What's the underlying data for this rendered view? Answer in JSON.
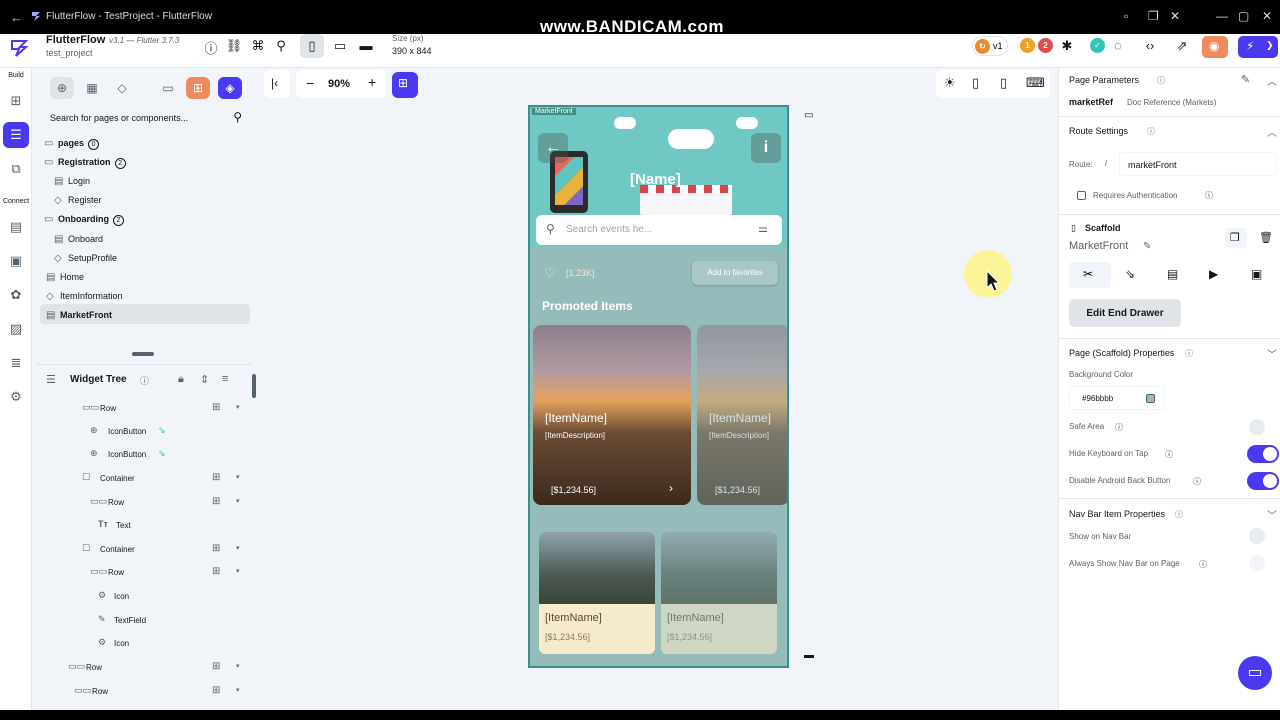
{
  "window": {
    "title": "FlutterFlow - TestProject - FlutterFlow",
    "watermark": "www.BANDICAM.com"
  },
  "header": {
    "brand": "FlutterFlow",
    "version": "v3.1 — Flutter 3.7.3",
    "project": "test_project",
    "size_label": "Size (px)",
    "size_value": "390 x 844",
    "version_pill": "v1",
    "warn_count": "1",
    "error_count": "2"
  },
  "rail": {
    "build_label": "Build",
    "connect_label": "Connect"
  },
  "left_panel": {
    "search_placeholder": "Search for pages or components...",
    "tree": [
      {
        "label": "pages",
        "badge": "0"
      },
      {
        "label": "Registration",
        "badge": "2"
      },
      {
        "label": "Login"
      },
      {
        "label": "Register"
      },
      {
        "label": "Onboarding",
        "badge": "2"
      },
      {
        "label": "Onboard"
      },
      {
        "label": "SetupProfile"
      },
      {
        "label": "Home"
      },
      {
        "label": "ItemInformation"
      },
      {
        "label": "MarketFront"
      }
    ],
    "widget_tree_title": "Widget Tree",
    "widgets": [
      "Row",
      "IconButton",
      "IconButton",
      "Container",
      "Row",
      "Text",
      "Container",
      "Row",
      "Icon",
      "TextField",
      "Icon",
      "Row",
      "Row"
    ]
  },
  "canvas": {
    "zoom": "90%",
    "page_name": "MarketFront",
    "hero_name": "[Name]",
    "search_placeholder": "Search events he...",
    "likes": "[1.23K]",
    "add_favorites": "Add to favorites",
    "promoted_title": "Promoted Items",
    "big_cards": [
      {
        "name": "[ItemName]",
        "desc": "[ItemDescription]",
        "price": "[$1,234.56]"
      },
      {
        "name": "[ItemName]",
        "desc": "[ItemDescription]",
        "price": "[$1,234.56]"
      }
    ],
    "small_cards": [
      {
        "name": "[ItemName]",
        "price": "[$1,234.56]"
      },
      {
        "name": "[ItemName]",
        "price": "[$1,234.56]"
      }
    ]
  },
  "right_panel": {
    "page_parameters": "Page Parameters",
    "param_name": "marketRef",
    "param_type": "Doc Reference (Markets)",
    "route_settings": "Route Settings",
    "route_label": "Route:",
    "route_slash": "/",
    "route_value": "marketFront",
    "requires_auth": "Requires Authentication",
    "scaffold_label": "Scaffold",
    "scaffold_name": "MarketFront",
    "edit_end_drawer": "Edit End Drawer",
    "scaffold_props": "Page (Scaffold) Properties",
    "bg_color_label": "Background Color",
    "bg_color_value": "#96bbbb",
    "safe_area": "Safe Area",
    "hide_keyboard": "Hide Keyboard on Tap",
    "disable_back": "Disable Android Back Button",
    "nav_bar_props": "Nav Bar Item Properties",
    "show_on_nav": "Show on Nav Bar",
    "always_show_nav": "Always Show Nav Bar on Page"
  },
  "colors": {
    "accent": "#4b39ef",
    "page_bg": "#96bbbb",
    "warn": "#ee8b2c",
    "error": "#e24c4c",
    "success": "#2fc6b4"
  }
}
